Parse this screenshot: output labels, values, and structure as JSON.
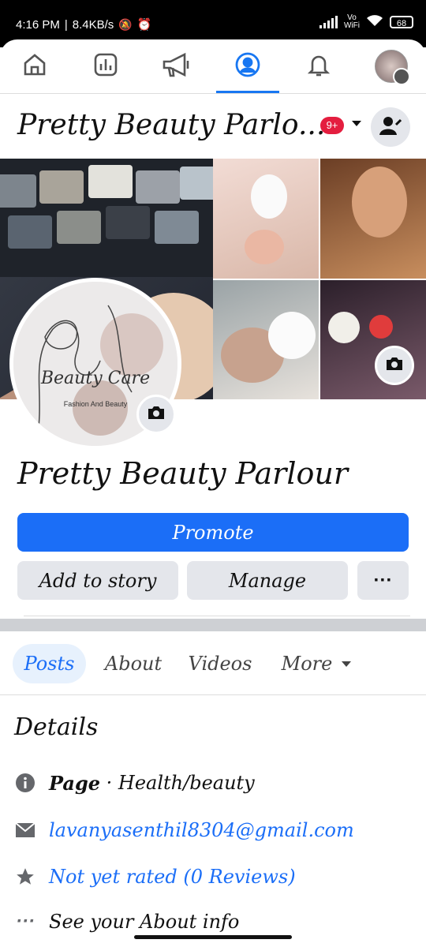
{
  "status_bar": {
    "time": "4:16 PM",
    "net_speed": "8.4KB/s",
    "network_label_top": "Vo",
    "network_label_bottom": "WiFi",
    "battery": "68"
  },
  "nav": {
    "items": [
      {
        "name": "home-icon"
      },
      {
        "name": "insights-icon"
      },
      {
        "name": "megaphone-icon"
      },
      {
        "name": "profile-icon"
      },
      {
        "name": "bell-icon"
      },
      {
        "name": "menu-avatar"
      }
    ],
    "active_index": 3,
    "accent": "#1877f2"
  },
  "header": {
    "title": "Pretty Beauty Parlo...",
    "badge": "9+"
  },
  "avatar": {
    "script_text": "Beauty Care",
    "tagline": "Fashion And Beauty"
  },
  "page_name": "Pretty Beauty Parlour",
  "buttons": {
    "promote": "Promote",
    "add_to_story": "Add to story",
    "manage": "Manage",
    "more": "···"
  },
  "tabs": [
    {
      "label": "Posts"
    },
    {
      "label": "About"
    },
    {
      "label": "Videos"
    },
    {
      "label": "More"
    }
  ],
  "details": {
    "title": "Details",
    "category_bold": "Page",
    "category_rest": " · Health/beauty",
    "email": "lavanyasenthil8304@gmail.com",
    "rating": "Not yet rated (0 Reviews)",
    "about": "See your About info"
  }
}
